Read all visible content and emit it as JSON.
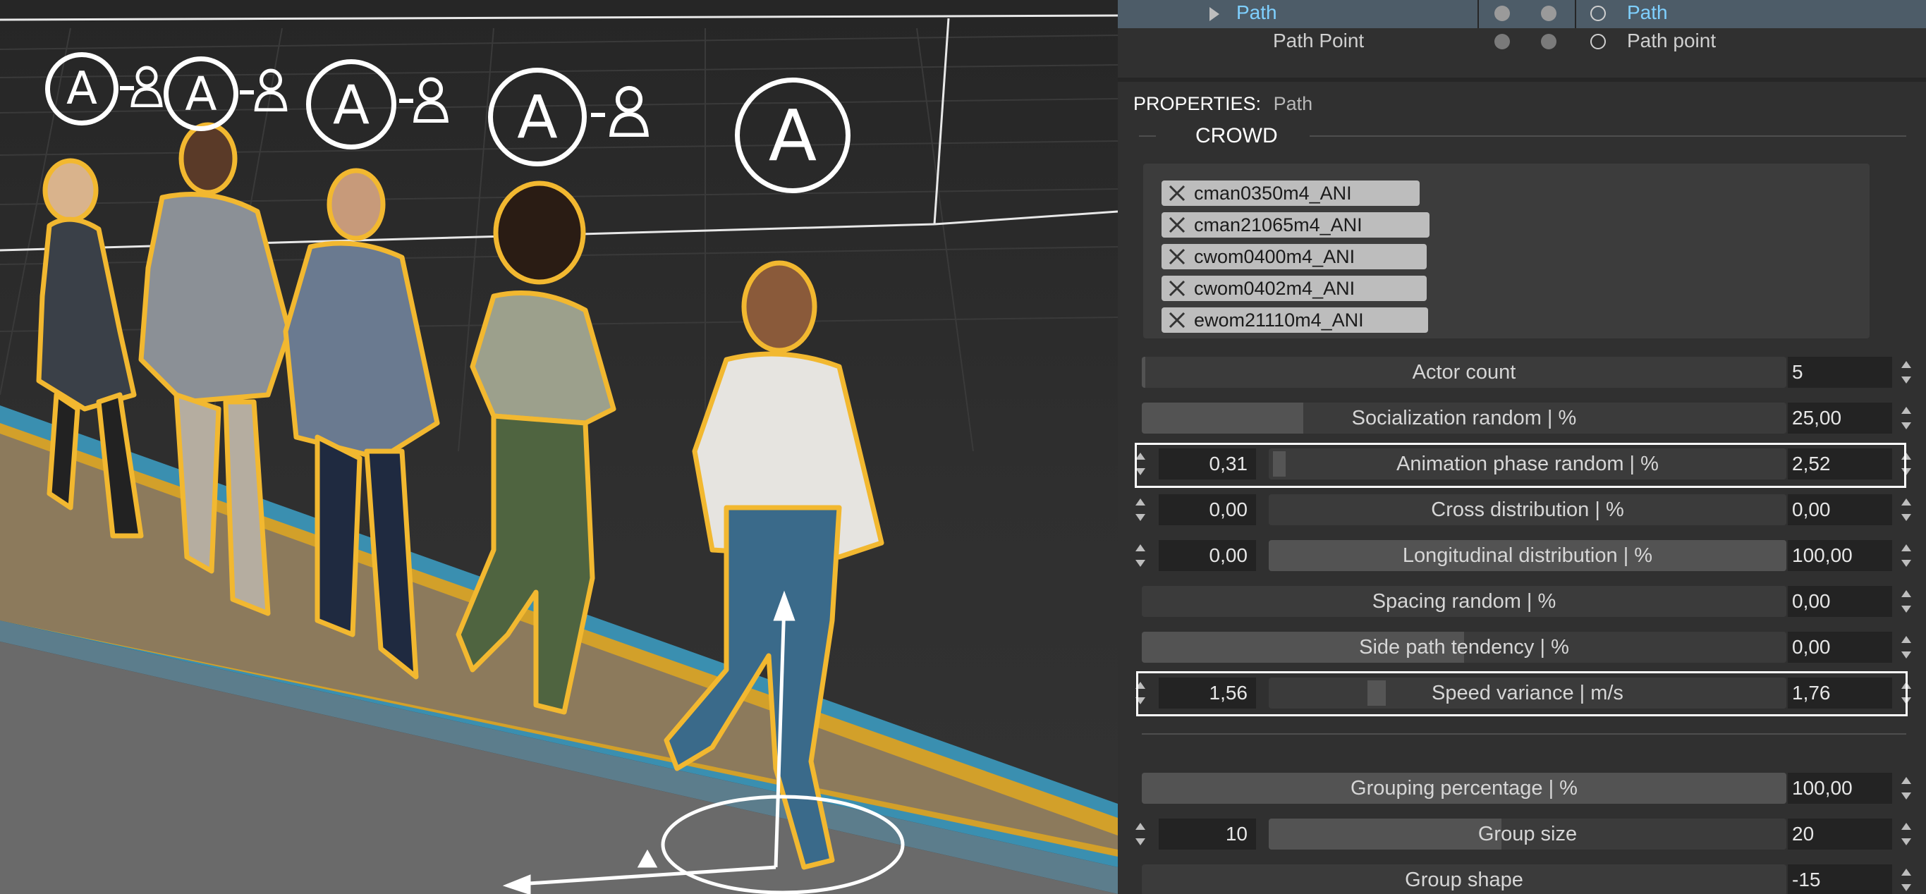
{
  "tree": {
    "expand_icon": "triangle-right-icon",
    "rows": [
      {
        "name": "Path",
        "type": "Path",
        "selected": true
      },
      {
        "name": "Path Point",
        "type": "Path point",
        "selected": false
      }
    ]
  },
  "properties": {
    "label": "PROPERTIES:",
    "object": "Path",
    "section": "CROWD"
  },
  "actors": [
    "cman0350m4_ANI",
    "cman21065m4_ANI",
    "cwom0400m4_ANI",
    "cwom0402m4_ANI",
    "ewom21110m4_ANI"
  ],
  "params": [
    {
      "label": "Actor count",
      "value": "5",
      "fill": 0.005
    },
    {
      "label": "Socialization random | %",
      "value": "25,00",
      "fill": 0.25
    },
    {
      "label": "Animation phase random | %",
      "value": "2,52",
      "min": "0,31",
      "fill": 0.0,
      "highlighted": true
    },
    {
      "label": "Cross distribution | %",
      "value": "0,00",
      "min": "0,00",
      "fill": 0.0
    },
    {
      "label": "Longitudinal distribution | %",
      "value": "100,00",
      "min": "0,00",
      "fill": 1.0
    },
    {
      "label": "Spacing random | %",
      "value": "0,00",
      "fill": 0.0
    },
    {
      "label": "Side path tendency | %",
      "value": "0,00",
      "fill": 0.5
    },
    {
      "label": "Speed variance | m/s",
      "value": "1,76",
      "min": "1,56",
      "fill": 0.0,
      "highlighted": true
    },
    {
      "label": "Grouping percentage | %",
      "value": "100,00",
      "fill": 1.0
    },
    {
      "label": "Group size",
      "value": "20",
      "min": "10",
      "fill": 0.45
    },
    {
      "label": "Group shape",
      "value": "-15",
      "fill": 0.0
    }
  ],
  "viewport": {
    "badge_letter": "A",
    "badge_count": 5,
    "person_icon": "person-silhouette-icon",
    "gizmo": "transform-gizmo-icon",
    "outline_color": "#f2b830",
    "walkway_color": "#8c7a5c",
    "edge_blue": "#3a8fb0",
    "edge_yellow": "#d2a02a"
  }
}
